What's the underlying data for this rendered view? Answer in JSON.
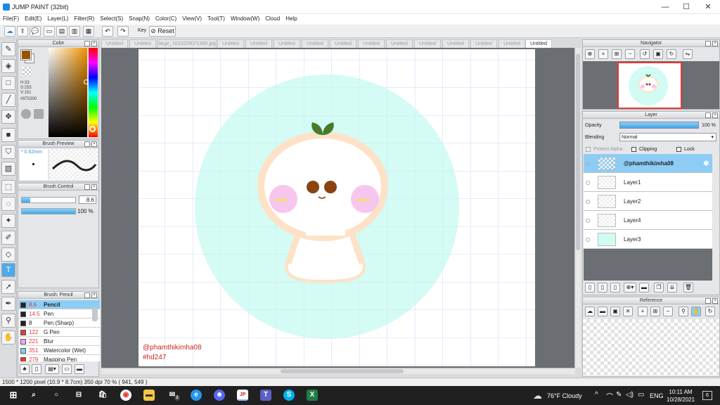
{
  "window": {
    "title": "JUMP PAINT (32bit)",
    "minimize": "—",
    "maximize": "☐",
    "close": "✕"
  },
  "menu": [
    "File(F)",
    "Edit(E)",
    "Layer(L)",
    "Filter(R)",
    "Select(S)",
    "Snap(N)",
    "Color(C)",
    "View(V)",
    "Tool(T)",
    "Window(W)",
    "Cloud",
    "Help"
  ],
  "toolbar": {
    "key_label": "Key",
    "reset_label": "Reset"
  },
  "tabs": [
    "Untitled",
    "Untitled",
    "large_1633229071995.jpg",
    "Untitled",
    "Untitled",
    "Untitled",
    "Untitled",
    "Untitled",
    "Untitled",
    "Untitled",
    "Untitled",
    "Untitled",
    "Untitled",
    "Untitled",
    "Untitled"
  ],
  "color_panel": {
    "title": "Color",
    "h": "H:33",
    "s": "S:255",
    "v": "V:151",
    "hex": "#975300",
    "main_color": "#975300"
  },
  "brush_preview": {
    "title": "Brush Preview",
    "size": "* 0.62mm"
  },
  "brush_control": {
    "title": "Brush Control",
    "size_value": "8.6",
    "opacity_value": "100 %"
  },
  "brush_list": {
    "title": "Brush: Pencil",
    "items": [
      {
        "color": "#222222",
        "size": "8.6",
        "name": "Pencil",
        "selected": true
      },
      {
        "color": "#222222",
        "size": "14.5",
        "name": "Pen",
        "selected": false
      },
      {
        "color": "#222222",
        "size": "8",
        "name": "Pen (Sharp)",
        "selected": false
      },
      {
        "color": "#e53935",
        "size": "122",
        "name": "G Pen",
        "selected": false
      },
      {
        "color": "#f3a6f5",
        "size": "221",
        "name": "Blur",
        "selected": false
      },
      {
        "color": "#7dd3f0",
        "size": "351",
        "name": "Watercolor (Wet)",
        "selected": false
      },
      {
        "color": "#e53935",
        "size": "279",
        "name": "Mapping Pen",
        "selected": false
      }
    ]
  },
  "navigator": {
    "title": "Navigator"
  },
  "layer_panel": {
    "title": "Layer",
    "opacity_label": "Opacity",
    "opacity_value": "100 %",
    "blending_label": "Blending",
    "blending_value": "Normal",
    "protect_alpha": "Protect Alpha",
    "clipping": "Clipping",
    "lock": "Lock",
    "layers": [
      {
        "name": "@phamthikimha08",
        "selected": true
      },
      {
        "name": "Layer1",
        "selected": false
      },
      {
        "name": "Layer2",
        "selected": false
      },
      {
        "name": "Layer4",
        "selected": false
      },
      {
        "name": "Layer3",
        "selected": false
      }
    ]
  },
  "reference": {
    "title": "Reference"
  },
  "canvas": {
    "watermark_line1": "@phamthikimha08",
    "watermark_line2": "#hd247",
    "bg_circle": "#d2fbf3",
    "outline": "#fde2c8",
    "cheek": "#f7c6ee",
    "eye": "#8a4410",
    "leaf": "#3f7f2c"
  },
  "status": {
    "text": "1500 * 1200 pixel   (10.9 * 8.7cm)   350 dpi   70 %   ( 941, 549 )"
  },
  "taskbar": {
    "weather": "76°F  Cloudy",
    "lang": "ENG",
    "time": "10:11 AM",
    "date": "10/28/2021",
    "notif_count": "6",
    "mail_badge": "2"
  }
}
